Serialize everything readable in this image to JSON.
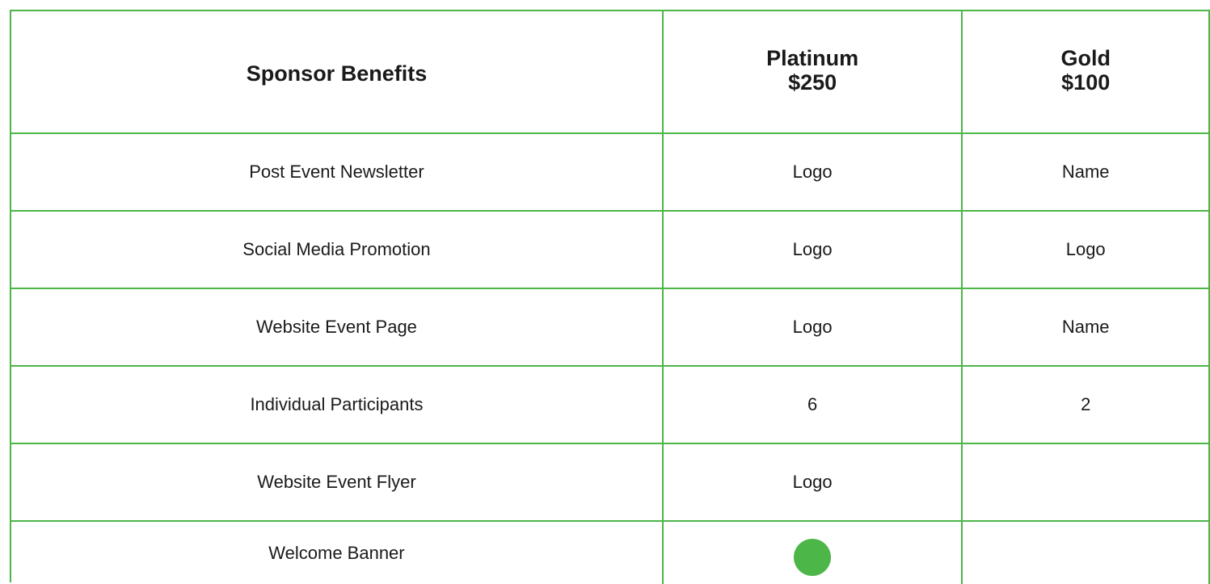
{
  "colors": {
    "grid": "#4cb648",
    "dot": "#4cb648"
  },
  "header": {
    "benefits_label": "Sponsor Benefits",
    "tiers": [
      {
        "name": "Platinum",
        "price": "$250"
      },
      {
        "name": "Gold",
        "price": "$100"
      }
    ]
  },
  "rows": [
    {
      "benefit": "Post Event Newsletter",
      "platinum": "Logo",
      "gold": "Name"
    },
    {
      "benefit": "Social Media Promotion",
      "platinum": "Logo",
      "gold": "Logo"
    },
    {
      "benefit": "Website Event Page",
      "platinum": "Logo",
      "gold": "Name"
    },
    {
      "benefit": "Individual Participants",
      "platinum": "6",
      "gold": "2"
    },
    {
      "benefit": "Website Event Flyer",
      "platinum": "Logo",
      "gold": ""
    },
    {
      "benefit": "Welcome Banner",
      "platinum_icon": "filled-circle-icon",
      "gold": ""
    }
  ]
}
